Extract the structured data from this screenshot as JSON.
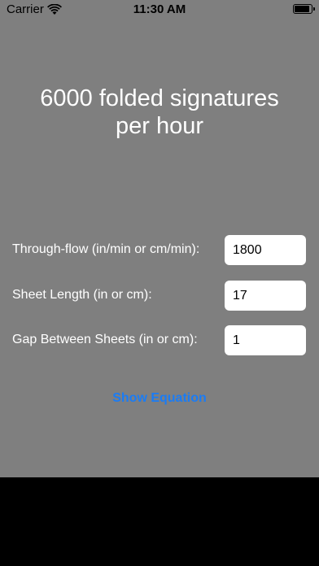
{
  "status_bar": {
    "carrier": "Carrier",
    "time": "11:30 AM",
    "wifi_icon": "wifi-icon",
    "battery_icon": "battery-icon"
  },
  "result": {
    "line1": "6000 folded signatures",
    "line2": "per hour"
  },
  "form": {
    "through_flow": {
      "label": "Through-flow (in/min or cm/min):",
      "value": "1800"
    },
    "sheet_length": {
      "label": "Sheet Length (in or cm):",
      "value": "17"
    },
    "gap": {
      "label": "Gap Between Sheets (in or cm):",
      "value": "1"
    }
  },
  "actions": {
    "show_equation": "Show Equation"
  },
  "colors": {
    "background": "#7f7f7f",
    "accent": "#1a7cf5",
    "bottom": "#000000"
  }
}
